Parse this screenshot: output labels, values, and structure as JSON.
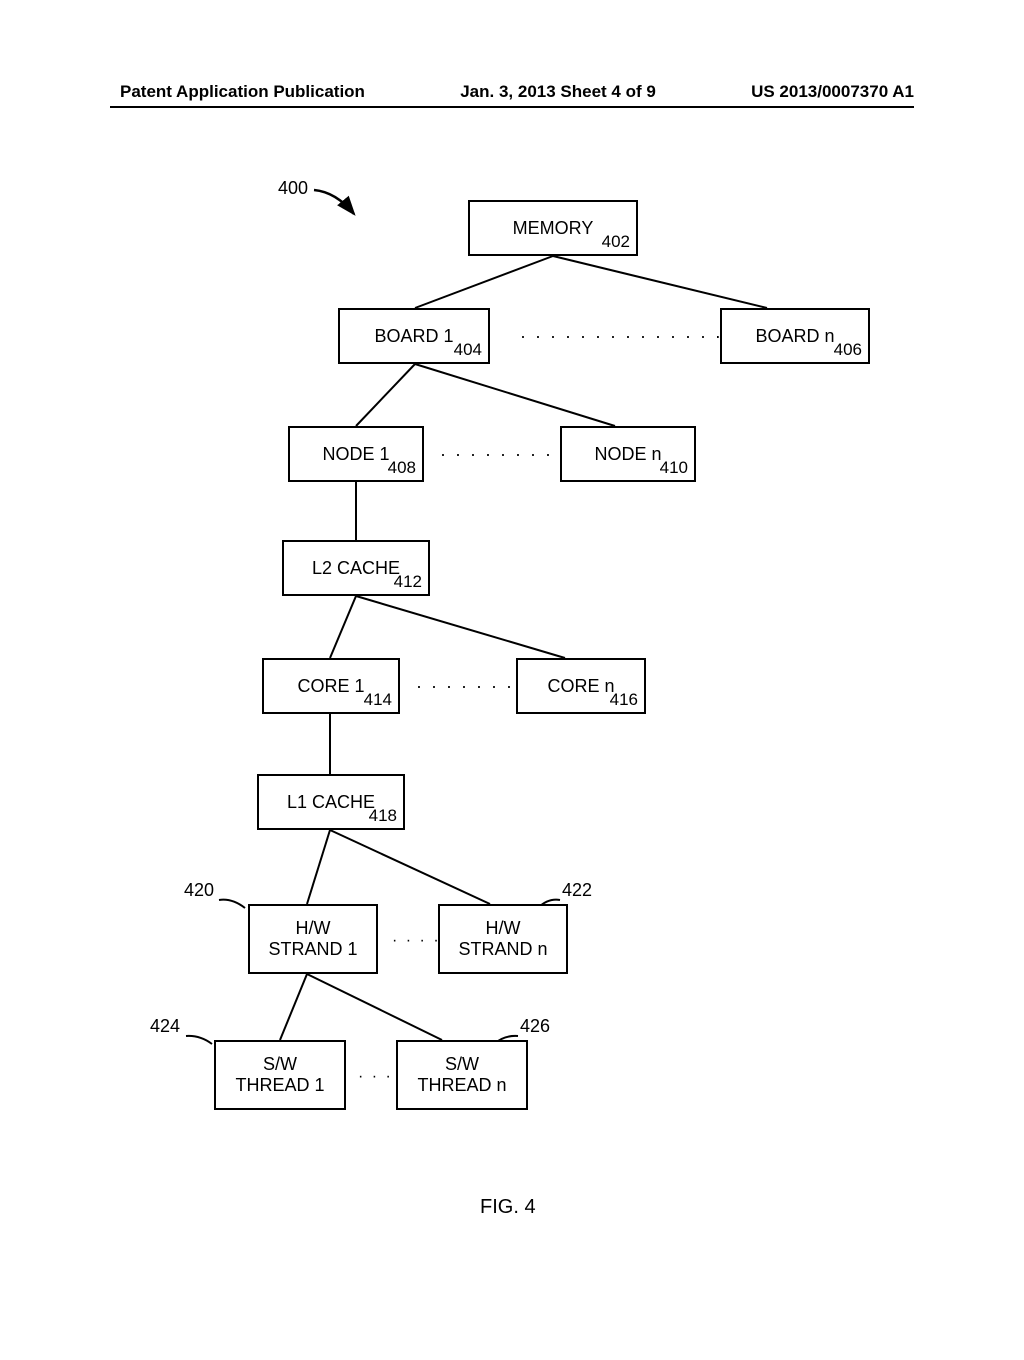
{
  "header": {
    "left": "Patent Application Publication",
    "center": "Jan. 3, 2013  Sheet 4 of 9",
    "right": "US 2013/0007370 A1"
  },
  "diagram": {
    "pointer_label": "400",
    "memory": {
      "label": "MEMORY",
      "ref": "402"
    },
    "board1": {
      "label": "BOARD 1",
      "ref": "404"
    },
    "boardn": {
      "label": "BOARD n",
      "ref": "406"
    },
    "node1": {
      "label": "NODE 1",
      "ref": "408"
    },
    "noden": {
      "label": "NODE n",
      "ref": "410"
    },
    "l2": {
      "label": "L2 CACHE",
      "ref": "412"
    },
    "core1": {
      "label": "CORE 1",
      "ref": "414"
    },
    "coren": {
      "label": "CORE n",
      "ref": "416"
    },
    "l1": {
      "label": "L1 CACHE",
      "ref": "418"
    },
    "hw1": {
      "label1": "H/W",
      "label2": "STRAND 1",
      "ref": "420"
    },
    "hwn": {
      "label1": "H/W",
      "label2": "STRAND n",
      "ref": "422"
    },
    "sw1": {
      "label1": "S/W",
      "label2": "THREAD 1",
      "ref": "424"
    },
    "swn": {
      "label1": "S/W",
      "label2": "THREAD n",
      "ref": "426"
    },
    "dots_long": "· · · · · · · · · · · · · ·",
    "dots_short": "· · · · · ·",
    "figure": "FIG. 4"
  }
}
